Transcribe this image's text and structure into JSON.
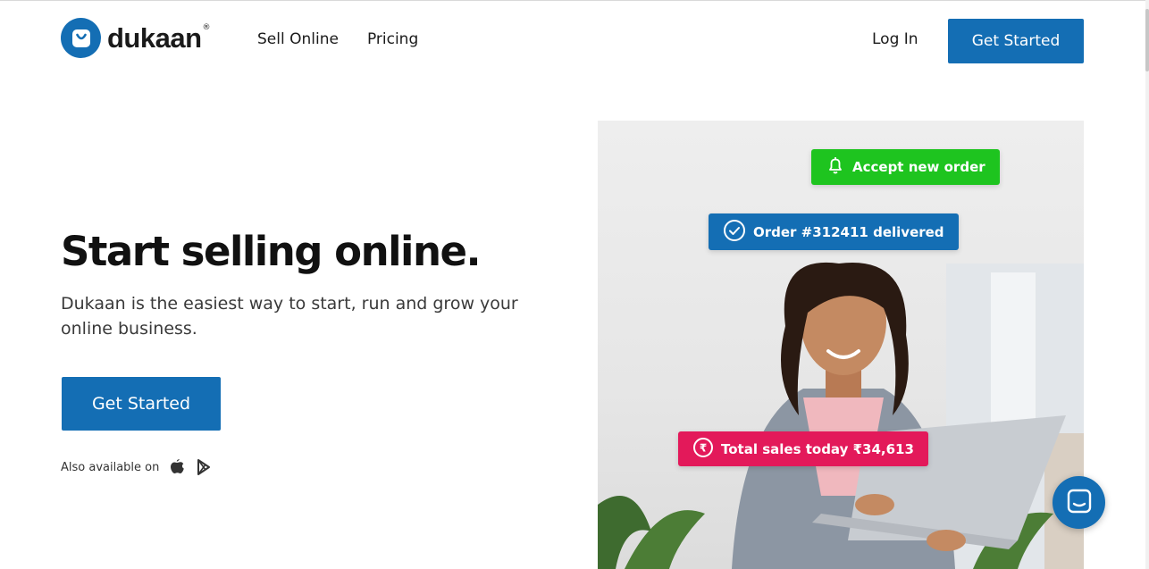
{
  "header": {
    "logo_text": "dukaan",
    "logo_mark": "®",
    "nav": [
      {
        "label": "Sell Online"
      },
      {
        "label": "Pricing"
      }
    ],
    "login_label": "Log In",
    "cta_label": "Get Started"
  },
  "hero": {
    "title": "Start selling online.",
    "subtitle": "Dukaan is the easiest way to start, run and grow your online business.",
    "cta_label": "Get Started",
    "available_label": "Also available on",
    "store_icons": [
      "apple-icon",
      "play-store-icon"
    ]
  },
  "badges": {
    "accept": {
      "label": "Accept new order",
      "icon": "bell-icon",
      "color": "#1ec41f"
    },
    "delivered": {
      "label": "Order #312411 delivered",
      "icon": "check-circle-icon",
      "color": "#146eb4"
    },
    "sales": {
      "label": "Total sales today ₹34,613",
      "icon": "rupee-circle-icon",
      "color": "#e3195a"
    }
  },
  "theme": {
    "brand": "#146eb4",
    "success": "#1ec41f",
    "pink": "#e3195a"
  },
  "chat": {
    "icon": "chat-icon"
  }
}
